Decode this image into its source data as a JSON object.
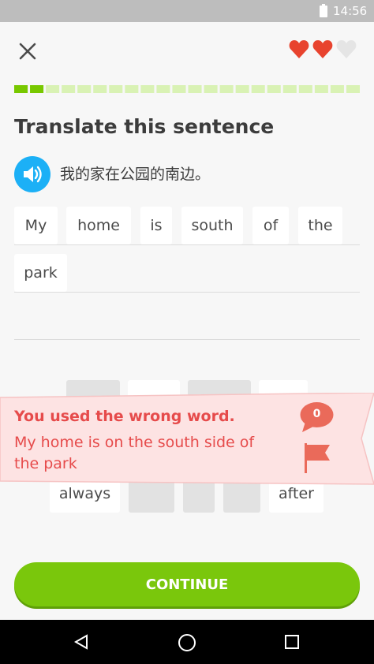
{
  "status_bar": {
    "time": "14:56"
  },
  "lesson": {
    "hearts": {
      "filled": 2,
      "total": 3,
      "filled_color": "#e8432e",
      "empty_color": "#e5e5e5"
    },
    "progress": {
      "completed_segments": 2,
      "total_segments": 22,
      "done_color": "#78c800",
      "todo_color": "#d9f2b4"
    },
    "title": "Translate this sentence",
    "prompt": "我的家在公园的南边。"
  },
  "answer_tiles": [
    "My",
    "home",
    "is",
    "south",
    "of",
    "the",
    "park"
  ],
  "word_bank": {
    "visible_words": [
      "always",
      "after"
    ]
  },
  "feedback": {
    "title": "You used the wrong word.",
    "correct_answer": "My home is on the south side of the park",
    "comment_count": "0",
    "color": "#e64b4b",
    "background": "#fde3e3"
  },
  "continue_label": "CONTINUE",
  "icons": [
    "close-icon",
    "heart-icon",
    "speaker-icon",
    "comment-bubble-icon",
    "flag-icon",
    "nav-back-icon",
    "nav-home-icon",
    "nav-recents-icon"
  ]
}
